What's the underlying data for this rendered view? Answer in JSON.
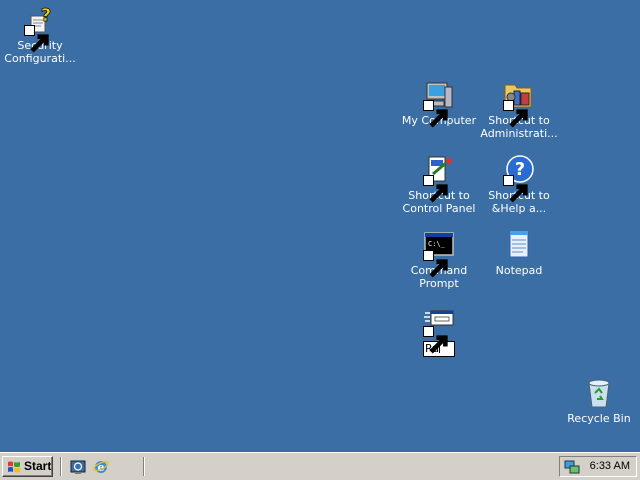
{
  "desktop": {
    "background": "#3a6ea5",
    "icons": [
      {
        "label": "Security Configurati...",
        "icon": "security-configuration-icon"
      },
      {
        "label": "My Computer",
        "icon": "my-computer-icon"
      },
      {
        "label": "Shortcut to Administrati...",
        "icon": "administrative-tools-icon"
      },
      {
        "label": "Shortcut to Control Panel",
        "icon": "control-panel-icon"
      },
      {
        "label": "Shortcut to &Help a...",
        "icon": "help-icon"
      },
      {
        "label": "Command Prompt",
        "icon": "command-prompt-icon"
      },
      {
        "label": "Notepad",
        "icon": "notepad-icon"
      },
      {
        "label": "",
        "icon": "run-icon",
        "rename_value": "Ru"
      },
      {
        "label": "Recycle Bin",
        "icon": "recycle-bin-icon"
      }
    ]
  },
  "taskbar": {
    "start_label": "Start",
    "quick_launch": [
      "show-desktop-icon",
      "internet-explorer-icon"
    ],
    "clock": "6:33 AM"
  }
}
